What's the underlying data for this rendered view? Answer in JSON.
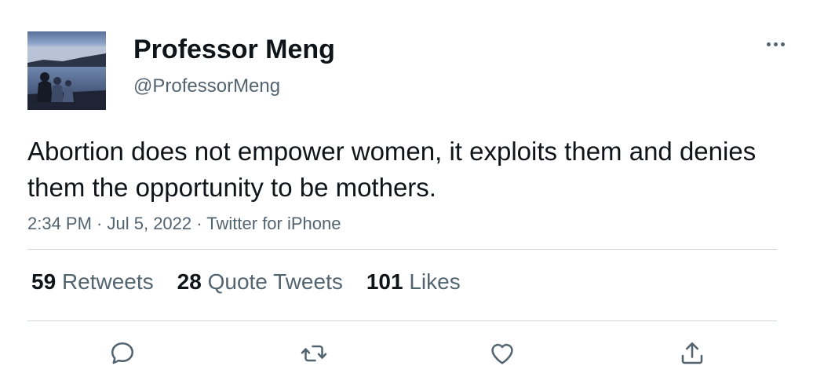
{
  "author": {
    "display_name": "Professor Meng",
    "handle": "@ProfessorMeng"
  },
  "tweet": {
    "text": "Abortion does not empower women, it exploits them and denies them the opportunity to be mothers.",
    "time": "2:34 PM",
    "date": "Jul 5, 2022",
    "source": "Twitter for iPhone",
    "separator": " · "
  },
  "stats": {
    "retweets": {
      "count": "59",
      "label": "Retweets"
    },
    "quote_tweets": {
      "count": "28",
      "label": "Quote Tweets"
    },
    "likes": {
      "count": "101",
      "label": "Likes"
    }
  },
  "icons": {
    "more": "more-horizontal-icon",
    "reply": "reply-icon",
    "retweet": "retweet-icon",
    "like": "heart-icon",
    "share": "share-icon"
  },
  "colors": {
    "text_primary": "#0f1419",
    "text_secondary": "#536471",
    "divider": "#cfd9de",
    "icon": "#536471"
  }
}
